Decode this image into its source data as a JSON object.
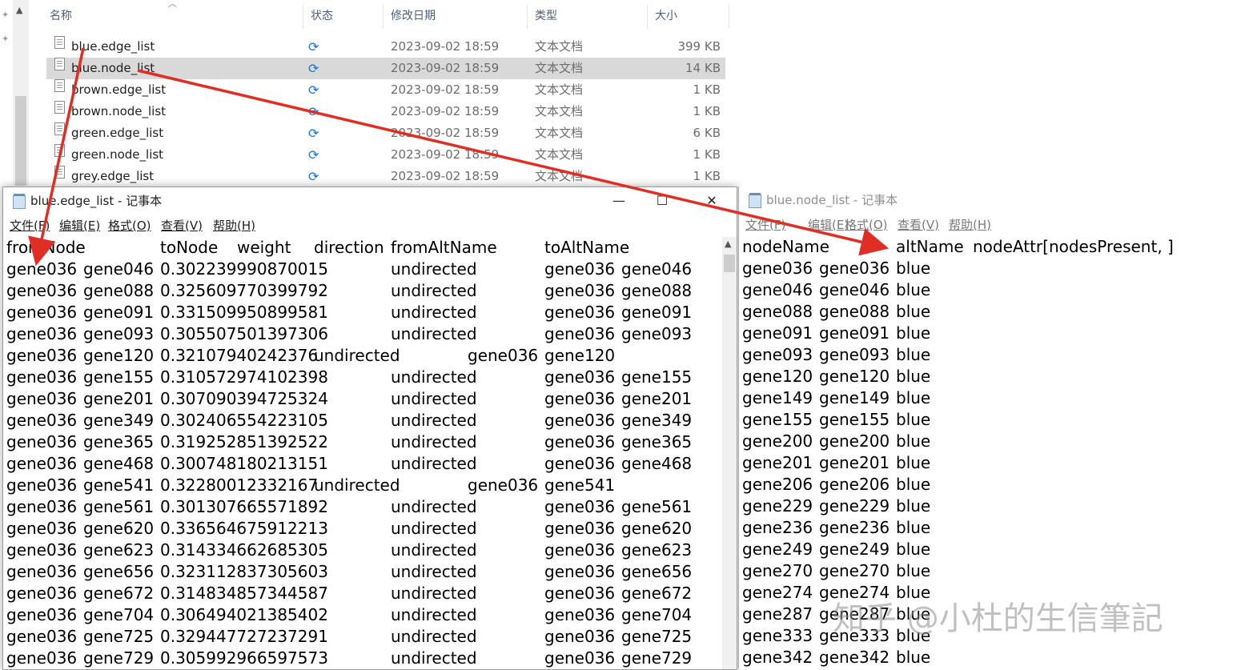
{
  "explorer": {
    "columns": {
      "name": "名称",
      "status": "状态",
      "modified": "修改日期",
      "type": "类型",
      "size": "大小"
    },
    "files": [
      {
        "name": "blue.edge_list",
        "sync": "⟳",
        "date": "2023-09-02 18:59",
        "type": "文本文档",
        "size": "399 KB",
        "selected": false
      },
      {
        "name": "blue.node_list",
        "sync": "⟳",
        "date": "2023-09-02 18:59",
        "type": "文本文档",
        "size": "14 KB",
        "selected": true
      },
      {
        "name": "brown.edge_list",
        "sync": "⟳",
        "date": "2023-09-02 18:59",
        "type": "文本文档",
        "size": "1 KB",
        "selected": false
      },
      {
        "name": "brown.node_list",
        "sync": "⟳",
        "date": "2023-09-02 18:59",
        "type": "文本文档",
        "size": "1 KB",
        "selected": false
      },
      {
        "name": "green.edge_list",
        "sync": "⟳",
        "date": "2023-09-02 18:59",
        "type": "文本文档",
        "size": "6 KB",
        "selected": false
      },
      {
        "name": "green.node_list",
        "sync": "⟳",
        "date": "2023-09-02 18:59",
        "type": "文本文档",
        "size": "1 KB",
        "selected": false
      },
      {
        "name": "grey.edge_list",
        "sync": "⟳",
        "date": "2023-09-02 18:59",
        "type": "文本文档",
        "size": "1 KB",
        "selected": false
      }
    ]
  },
  "edge_window": {
    "title": "blue.edge_list - 记事本",
    "menu": [
      "文件(F)",
      "编辑(E)",
      "格式(O)",
      "查看(V)",
      "帮助(H)"
    ],
    "header": [
      "fromNode",
      "toNode",
      "weight",
      "direction",
      "fromAltName",
      "toAltName"
    ],
    "rows": [
      [
        "gene036",
        "gene046",
        "0.302239990870015",
        "undirected",
        "gene036",
        "gene046"
      ],
      [
        "gene036",
        "gene088",
        "0.325609770399792",
        "undirected",
        "gene036",
        "gene088"
      ],
      [
        "gene036",
        "gene091",
        "0.331509950899581",
        "undirected",
        "gene036",
        "gene091"
      ],
      [
        "gene036",
        "gene093",
        "0.305507501397306",
        "undirected",
        "gene036",
        "gene093"
      ],
      [
        "gene036",
        "gene120",
        "0.32107940242376",
        "undirected",
        "gene036",
        "gene120"
      ],
      [
        "gene036",
        "gene155",
        "0.310572974102398",
        "undirected",
        "gene036",
        "gene155"
      ],
      [
        "gene036",
        "gene201",
        "0.307090394725324",
        "undirected",
        "gene036",
        "gene201"
      ],
      [
        "gene036",
        "gene349",
        "0.302406554223105",
        "undirected",
        "gene036",
        "gene349"
      ],
      [
        "gene036",
        "gene365",
        "0.319252851392522",
        "undirected",
        "gene036",
        "gene365"
      ],
      [
        "gene036",
        "gene468",
        "0.300748180213151",
        "undirected",
        "gene036",
        "gene468"
      ],
      [
        "gene036",
        "gene541",
        "0.32280012332167",
        "undirected",
        "gene036",
        "gene541"
      ],
      [
        "gene036",
        "gene561",
        "0.301307665571892",
        "undirected",
        "gene036",
        "gene561"
      ],
      [
        "gene036",
        "gene620",
        "0.336564675912213",
        "undirected",
        "gene036",
        "gene620"
      ],
      [
        "gene036",
        "gene623",
        "0.314334662685305",
        "undirected",
        "gene036",
        "gene623"
      ],
      [
        "gene036",
        "gene656",
        "0.323112837305603",
        "undirected",
        "gene036",
        "gene656"
      ],
      [
        "gene036",
        "gene672",
        "0.314834857344587",
        "undirected",
        "gene036",
        "gene672"
      ],
      [
        "gene036",
        "gene704",
        "0.306494021385402",
        "undirected",
        "gene036",
        "gene704"
      ],
      [
        "gene036",
        "gene725",
        "0.329447727237291",
        "undirected",
        "gene036",
        "gene725"
      ],
      [
        "gene036",
        "gene729",
        "0.305992966597573",
        "undirected",
        "gene036",
        "gene729"
      ]
    ]
  },
  "node_window": {
    "title": "blue.node_list - 记事本",
    "menu": [
      "文件(F)",
      "编辑(E)",
      "格式(O)",
      "查看(V)",
      "帮助(H)"
    ],
    "header": [
      "nodeName",
      "altName",
      "nodeAttr[nodesPresent, ]"
    ],
    "rows": [
      [
        "gene036",
        "gene036",
        "blue"
      ],
      [
        "gene046",
        "gene046",
        "blue"
      ],
      [
        "gene088",
        "gene088",
        "blue"
      ],
      [
        "gene091",
        "gene091",
        "blue"
      ],
      [
        "gene093",
        "gene093",
        "blue"
      ],
      [
        "gene120",
        "gene120",
        "blue"
      ],
      [
        "gene149",
        "gene149",
        "blue"
      ],
      [
        "gene155",
        "gene155",
        "blue"
      ],
      [
        "gene200",
        "gene200",
        "blue"
      ],
      [
        "gene201",
        "gene201",
        "blue"
      ],
      [
        "gene206",
        "gene206",
        "blue"
      ],
      [
        "gene229",
        "gene229",
        "blue"
      ],
      [
        "gene236",
        "gene236",
        "blue"
      ],
      [
        "gene249",
        "gene249",
        "blue"
      ],
      [
        "gene270",
        "gene270",
        "blue"
      ],
      [
        "gene274",
        "gene274",
        "blue"
      ],
      [
        "gene287",
        "gene287",
        "blue"
      ],
      [
        "gene333",
        "gene333",
        "blue"
      ],
      [
        "gene342",
        "gene342",
        "blue"
      ]
    ]
  },
  "watermark": "知乎 @小杜的生信筆記",
  "colors": {
    "arrow": "#e02e24",
    "selection": "#d9d9d9",
    "sync_icon": "#1a73d9"
  }
}
